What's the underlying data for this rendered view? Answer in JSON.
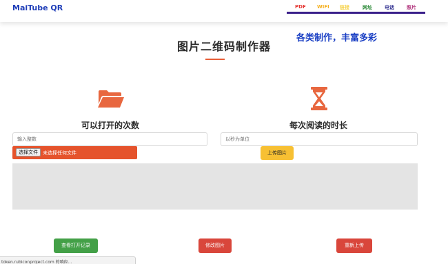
{
  "header": {
    "logo": "MaiTube QR",
    "nav": [
      {
        "label": "PDF",
        "color": "#e53935"
      },
      {
        "label": "WIFI",
        "color": "#f6b01e"
      },
      {
        "label": "链接",
        "color": "#f6d34a"
      },
      {
        "label": "网址",
        "color": "#2e8b3a"
      },
      {
        "label": "电话",
        "color": "#2d2d8f"
      },
      {
        "label": "照片",
        "color": "#b0307a"
      }
    ],
    "nav_underline_color": "#3a1f8a"
  },
  "main": {
    "title": "图片二维码制作器",
    "slogan": "各类制作，丰富多彩",
    "accent_color": "#e85d37",
    "left": {
      "icon": "folder-open-icon",
      "label": "可以打开的次数",
      "input_placeholder": "输入整数"
    },
    "right": {
      "icon": "hourglass-icon",
      "label": "每次阅读的时长",
      "input_placeholder": "以秒为单位"
    },
    "file_input": {
      "button_label": "选择文件",
      "status": "未选择任何文件"
    },
    "upload_button": "上传图片"
  },
  "actions": {
    "view_log": "查看打开记录",
    "edit_image": "修改图片",
    "reupload": "重新上传"
  },
  "status_bar": {
    "text": "token.rubiconproject.com 的响应..."
  }
}
